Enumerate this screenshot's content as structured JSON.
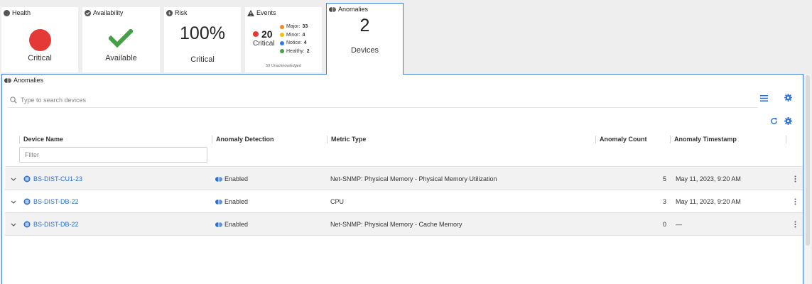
{
  "cards": {
    "health": {
      "title": "Health",
      "status": "Critical"
    },
    "availability": {
      "title": "Availability",
      "status": "Available"
    },
    "risk": {
      "title": "Risk",
      "value": "100%",
      "status": "Critical"
    },
    "events": {
      "title": "Events",
      "critical_count": "20",
      "critical_label": "Critical",
      "breakdown": [
        {
          "label": "Major:",
          "count": "33",
          "color": "#f08a24"
        },
        {
          "label": "Minor:",
          "count": "4",
          "color": "#f2c200"
        },
        {
          "label": "Notice:",
          "count": "4",
          "color": "#2f7de1"
        },
        {
          "label": "Healthy:",
          "count": "2",
          "color": "#43a047"
        }
      ],
      "unacknowledged": "59 Unacknowledged"
    },
    "anomalies": {
      "title": "Anomalies",
      "value": "2",
      "label": "Devices"
    }
  },
  "panel": {
    "title": "Anomalies",
    "search_placeholder": "Type to search devices",
    "filter_placeholder": "Filter"
  },
  "table": {
    "columns": [
      "Device Name",
      "Anomaly Detection",
      "Metric Type",
      "Anomaly Count",
      "Anomaly Timestamp"
    ],
    "rows": [
      {
        "device": "BS-DIST-CU1-23",
        "detection": "Enabled",
        "metric": "Net-SNMP: Physical Memory - Physical Memory Utilization",
        "count": "5",
        "timestamp": "May 11, 2023, 9:20 AM"
      },
      {
        "device": "BS-DIST-DB-22",
        "detection": "Enabled",
        "metric": "CPU",
        "count": "3",
        "timestamp": "May 11, 2023, 9:20 AM"
      },
      {
        "device": "BS-DIST-DB-22",
        "detection": "Enabled",
        "metric": "Net-SNMP: Physical Memory - Cache Memory",
        "count": "0",
        "timestamp": "—"
      }
    ]
  },
  "colors": {
    "accent": "#3f7dd8",
    "critical": "#e53935",
    "available": "#43a047",
    "link": "#2a6fcf"
  }
}
